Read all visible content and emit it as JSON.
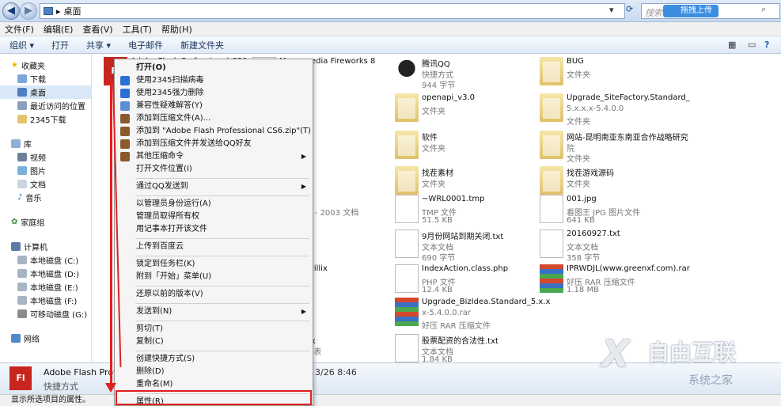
{
  "address": {
    "path": "桌面",
    "search_placeholder": "搜索",
    "upload_label": "拖拽上传"
  },
  "menu": [
    "文件(F)",
    "编辑(E)",
    "查看(V)",
    "工具(T)",
    "帮助(H)"
  ],
  "toolbar": [
    "组织 ▾",
    "打开",
    "共享 ▾",
    "电子邮件",
    "新建文件夹"
  ],
  "sidebar": {
    "favorites": {
      "title": "收藏夹",
      "items": [
        "下载",
        "桌面",
        "最近访问的位置",
        "2345下载"
      ]
    },
    "library": {
      "title": "库",
      "items": [
        "视频",
        "图片",
        "文档",
        "音乐"
      ]
    },
    "homegroup": "家庭组",
    "computer": {
      "title": "计算机",
      "items": [
        "本地磁盘 (C:)",
        "本地磁盘 (D:)",
        "本地磁盘 (E:)",
        "本地磁盘 (F:)",
        "可移动磁盘 (G:)"
      ]
    },
    "network": "网络"
  },
  "files": [
    {
      "name": "Adobe Flash Professional CS6",
      "t1": "",
      "t2": "",
      "icon": "flash"
    },
    {
      "name": "Macromedia Fireworks 8",
      "t1": "",
      "t2": "",
      "icon": "doc"
    },
    {
      "name": "腾讯QQ",
      "t1": "快捷方式",
      "t2": "944 字节",
      "icon": "qq"
    },
    {
      "name": "BUG",
      "t1": "文件夹",
      "t2": "",
      "icon": "folder"
    },
    {
      "name": "openapi_v3.0",
      "t1": "文件夹",
      "t2": "",
      "icon": "folder"
    },
    {
      "name": "Upgrade_SiteFactory.Standard_",
      "t1": "5.x.x.x-5.4.0.0",
      "t2": "文件夹",
      "icon": "folder"
    },
    {
      "name": "软件",
      "t1": "文件夹",
      "t2": "",
      "icon": "folder"
    },
    {
      "name": "网站-昆明南亚东南亚合作战略研究",
      "t1": "院",
      "t2": "文件夹",
      "icon": "folder"
    },
    {
      "name": "找茬素材",
      "t1": "文件夹",
      "t2": "",
      "icon": "folder"
    },
    {
      "name": "找茬游戏源码",
      "t1": "文件夹",
      "t2": "",
      "icon": "folder"
    },
    {
      "name": "doc",
      "t1": "Word 97 - 2003 文档",
      "t2": "",
      "icon": "doc"
    },
    {
      "name": "~WRL0001.tmp",
      "t1": "TMP 文件",
      "t2": "51.5 KB",
      "icon": "doc"
    },
    {
      "name": "001.jpg",
      "t1": "看图王 JPG 图片文件",
      "t2": "641 KB",
      "icon": "doc"
    },
    {
      "name": "",
      "t1": "图片文件",
      "t2": "",
      "icon": "none"
    },
    {
      "name": "9月份网站到期关闭.txt",
      "t1": "文本文档",
      "t2": "690 字节",
      "icon": "doc"
    },
    {
      "name": "20160927.txt",
      "t1": "文本文档",
      "t2": "358 字节",
      "icon": "doc"
    },
    {
      "name": "mpiler Trillix",
      "t1": "",
      "t2": "",
      "icon": "none"
    },
    {
      "name": "IndexAction.class.php",
      "t1": "PHP 文件",
      "t2": "12.4 KB",
      "icon": "doc"
    },
    {
      "name": "IPRWDJL(www.greenxf.com).rar",
      "t1": "好压 RAR 压缩文件",
      "t2": "1.18 MB",
      "icon": "rar"
    },
    {
      "name": "Upgrade_BizIdea.Standard_5.x.x",
      "t1": "x-5.4.0.0.rar",
      "t2": "好压 RAR 压缩文件",
      "icon": "rar"
    },
    {
      "name": "18）.xlsx",
      "t1": "xcel 工作表",
      "t2": "",
      "icon": "none"
    },
    {
      "name": "股票配资的合法性.txt",
      "t1": "文本文档",
      "t2": "1.84 KB",
      "icon": "doc"
    }
  ],
  "context_menu": [
    {
      "label": "打开(O)",
      "bold": true
    },
    {
      "label": "使用2345扫描病毒"
    },
    {
      "label": "使用2345强力删除"
    },
    {
      "label": "兼容性疑难解答(Y)"
    },
    {
      "label": "添加到压缩文件(A)..."
    },
    {
      "label": "添加到 \"Adobe Flash Professional CS6.zip\"(T)"
    },
    {
      "label": "添加到压缩文件并发送给QQ好友"
    },
    {
      "label": "其他压缩命令",
      "sub": true
    },
    {
      "label": "打开文件位置(I)"
    },
    {
      "sep": true
    },
    {
      "label": "通过QQ发送到",
      "sub": true
    },
    {
      "sep": true
    },
    {
      "label": "以管理员身份运行(A)"
    },
    {
      "label": "管理员取得所有权"
    },
    {
      "label": "用记事本打开该文件"
    },
    {
      "sep": true
    },
    {
      "label": "上传到百度云"
    },
    {
      "sep": true
    },
    {
      "label": "锁定到任务栏(K)"
    },
    {
      "label": "附到「开始」菜单(U)"
    },
    {
      "sep": true
    },
    {
      "label": "还原以前的版本(V)"
    },
    {
      "sep": true
    },
    {
      "label": "发送到(N)",
      "sub": true
    },
    {
      "sep": true
    },
    {
      "label": "剪切(T)"
    },
    {
      "label": "复制(C)"
    },
    {
      "sep": true
    },
    {
      "label": "创建快捷方式(S)"
    },
    {
      "label": "删除(D)"
    },
    {
      "label": "重命名(M)"
    },
    {
      "sep": true
    },
    {
      "label": "属性(R)"
    }
  ],
  "details": {
    "name": "Adobe Flash Profess",
    "type": "快捷方式",
    "date": "3/26 8:46"
  },
  "status": "显示所选项目的属性。",
  "watermark": {
    "brand": "自由互联",
    "sub": "系统之家"
  },
  "colors": {
    "annotation_red": "#e02020",
    "flash_red": "#c7261f"
  }
}
